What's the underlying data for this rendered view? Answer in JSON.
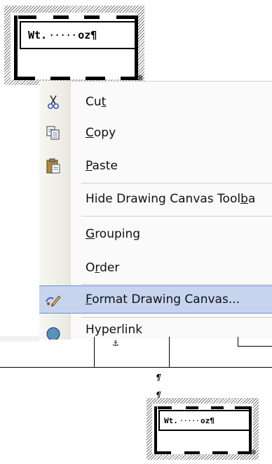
{
  "canvas_top": {
    "text_left": "Wt.",
    "text_dots": "·····",
    "text_right": "oz¶"
  },
  "menu": {
    "items": [
      {
        "pre": "Cu",
        "acc": "t",
        "post": "",
        "icon": "scissors-icon"
      },
      {
        "pre": "",
        "acc": "C",
        "post": "opy",
        "icon": "copy-icon"
      },
      {
        "pre": "",
        "acc": "P",
        "post": "aste",
        "icon": "clipboard-icon"
      },
      {
        "pre": "Hide Drawing Canvas Tool",
        "acc": "b",
        "post": "a",
        "icon": ""
      },
      {
        "pre": "",
        "acc": "G",
        "post": "rouping",
        "icon": ""
      },
      {
        "pre": "O",
        "acc": "r",
        "post": "der",
        "icon": ""
      },
      {
        "pre": "",
        "acc": "F",
        "post": "ormat Drawing Canvas...",
        "icon": "format-canvas-icon"
      },
      {
        "pre": "Hyperlink",
        "acc": "",
        "post": "",
        "icon": "globe-icon"
      }
    ]
  },
  "doc": {
    "pilcrow_1": "¶",
    "pilcrow_2": "¶",
    "anchor": "⚓"
  },
  "canvas_bottom": {
    "text_left": "Wt.",
    "text_dots": "·····",
    "text_right": "oz¶"
  }
}
